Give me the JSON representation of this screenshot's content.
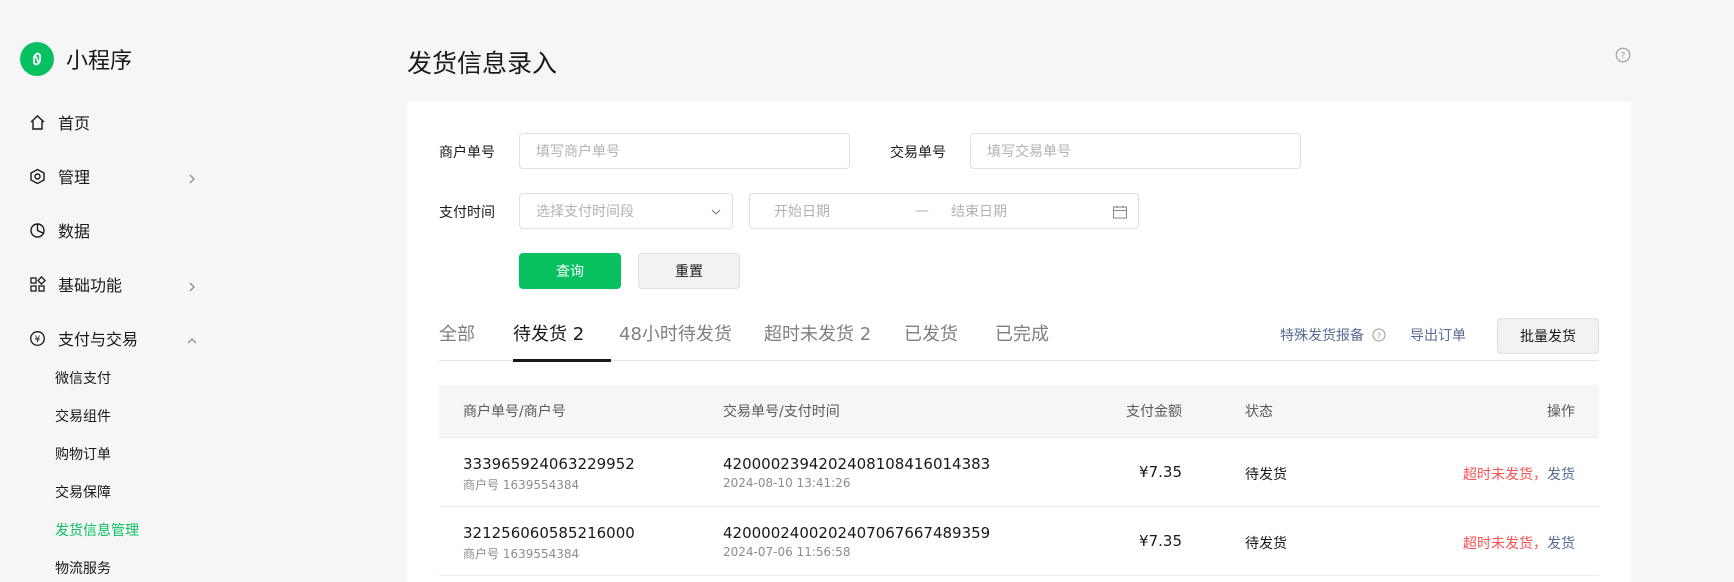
{
  "sidebar": {
    "brand": "小程序",
    "items": [
      {
        "label": "首页",
        "icon": "home-icon"
      },
      {
        "label": "管理",
        "icon": "manage-icon"
      },
      {
        "label": "数据",
        "icon": "chart-icon"
      },
      {
        "label": "基础功能",
        "icon": "grid-icon"
      },
      {
        "label": "支付与交易",
        "icon": "yuan-icon"
      }
    ],
    "sub_items": [
      "微信支付",
      "交易组件",
      "购物订单",
      "交易保障",
      "发货信息管理",
      "物流服务"
    ],
    "active_sub": "发货信息管理",
    "accent_color": "#07c160"
  },
  "page": {
    "title": "发货信息录入"
  },
  "filters": {
    "merchant_label": "商户单号",
    "merchant_placeholder": "填写商户单号",
    "trade_label": "交易单号",
    "trade_placeholder": "填写交易单号",
    "paytime_label": "支付时间",
    "paytime_select_placeholder": "选择支付时间段",
    "start_date_placeholder": "开始日期",
    "range_sep": "—",
    "end_date_placeholder": "结束日期",
    "query_button": "查询",
    "reset_button": "重置"
  },
  "tabs": [
    {
      "label": "全部"
    },
    {
      "label": "待发货 2"
    },
    {
      "label": "48小时待发货"
    },
    {
      "label": "超时未发货 2"
    },
    {
      "label": "已发货"
    },
    {
      "label": "已完成"
    }
  ],
  "active_tab": "待发货 2",
  "actions": {
    "special_report": "特殊发货报备",
    "export": "导出订单",
    "batch_ship": "批量发货"
  },
  "table": {
    "columns": [
      "商户单号/商户号",
      "交易单号/支付时间",
      "支付金额",
      "状态",
      "操作"
    ],
    "rows": [
      {
        "merchant_order": "333965924063229952",
        "merchant_id": "商户号 1639554384",
        "trade_no": "4200002394202408108416014383",
        "pay_time": "2024-08-10 13:41:26",
        "amount": "¥7.35",
        "status": "待发货",
        "op_overdue": "超时未发货，",
        "op_ship": "发货"
      },
      {
        "merchant_order": "321256060585216000",
        "merchant_id": "商户号 1639554384",
        "trade_no": "4200002400202407067667489359",
        "pay_time": "2024-07-06 11:56:58",
        "amount": "¥7.35",
        "status": "待发货",
        "op_overdue": "超时未发货，",
        "op_ship": "发货"
      }
    ]
  }
}
